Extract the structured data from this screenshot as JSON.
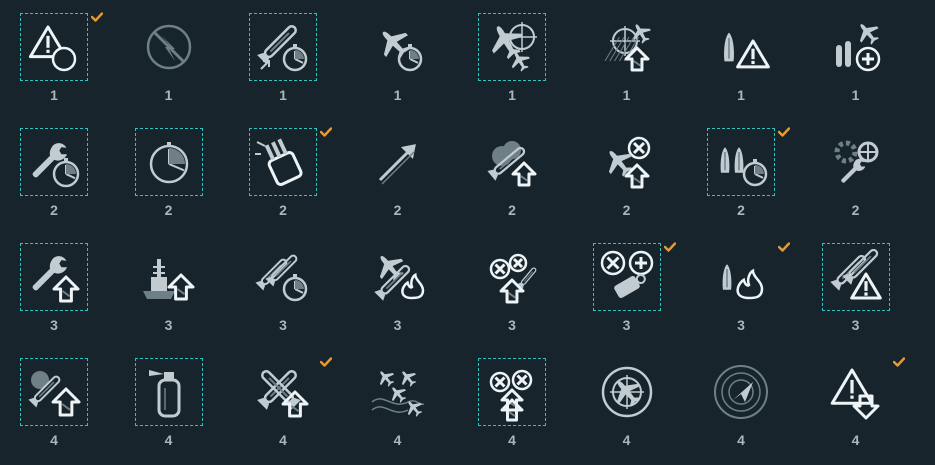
{
  "colors": {
    "background": "#17242c",
    "icon_primary": "#c2ccd0",
    "icon_dim": "#6f7f86",
    "icon_bright": "#eef3f5",
    "selection_border": "#2ec4c0",
    "check": "#e99a2e",
    "tier_text": "#aab6bb"
  },
  "rows": [
    {
      "tier": "1",
      "cells": [
        {
          "icon": "warning-timer-icon",
          "selected": true,
          "checked": true
        },
        {
          "icon": "disabled-aa-icon",
          "selected": false,
          "checked": false
        },
        {
          "icon": "torpedo-timer-icon",
          "selected": true,
          "checked": false
        },
        {
          "icon": "plane-timer-icon",
          "selected": false,
          "checked": false
        },
        {
          "icon": "fighter-squadron-icon",
          "selected": true,
          "checked": false
        },
        {
          "icon": "crosshair-plane-upgrade-icon",
          "selected": false,
          "checked": false
        },
        {
          "icon": "ship-warning-icon",
          "selected": false,
          "checked": false
        },
        {
          "icon": "plane-ammo-heal-icon",
          "selected": false,
          "checked": false
        }
      ]
    },
    {
      "tier": "2",
      "cells": [
        {
          "icon": "wrench-timer-icon",
          "selected": true,
          "checked": false
        },
        {
          "icon": "stopwatch-icon",
          "selected": true,
          "checked": false
        },
        {
          "icon": "turret-icon",
          "selected": true,
          "checked": true
        },
        {
          "icon": "shell-upgrade-icon",
          "selected": false,
          "checked": false
        },
        {
          "icon": "smoke-armor-upgrade-icon",
          "selected": false,
          "checked": false
        },
        {
          "icon": "plane-target-upgrade-icon",
          "selected": false,
          "checked": false
        },
        {
          "icon": "ships-timer-icon",
          "selected": true,
          "checked": true
        },
        {
          "icon": "gears-wrench-icon",
          "selected": false,
          "checked": false
        }
      ]
    },
    {
      "tier": "3",
      "cells": [
        {
          "icon": "wrench-upgrade-icon",
          "selected": true,
          "checked": false
        },
        {
          "icon": "battleship-upgrade-icon",
          "selected": false,
          "checked": false
        },
        {
          "icon": "torpedoes-timer-icon",
          "selected": false,
          "checked": false
        },
        {
          "icon": "plane-fire-icon",
          "selected": false,
          "checked": false
        },
        {
          "icon": "targets-shells-icon",
          "selected": false,
          "checked": false
        },
        {
          "icon": "repair-heal-icon",
          "selected": true,
          "checked": true
        },
        {
          "icon": "ship-fire-icon",
          "selected": false,
          "checked": true
        },
        {
          "icon": "torpedoes-warning-icon",
          "selected": true,
          "checked": false
        }
      ]
    },
    {
      "tier": "4",
      "cells": [
        {
          "icon": "shells-upgrade-icon",
          "selected": true,
          "checked": false
        },
        {
          "icon": "extinguisher-icon",
          "selected": true,
          "checked": false
        },
        {
          "icon": "crossed-torpedoes-upgrade-icon",
          "selected": false,
          "checked": true
        },
        {
          "icon": "planes-map-icon",
          "selected": false,
          "checked": false
        },
        {
          "icon": "targets-double-upgrade-icon",
          "selected": true,
          "checked": false
        },
        {
          "icon": "radar-plane-icon",
          "selected": false,
          "checked": false
        },
        {
          "icon": "radar-compass-icon",
          "selected": false,
          "checked": false
        },
        {
          "icon": "warning-downgrade-icon",
          "selected": false,
          "checked": true
        }
      ]
    }
  ]
}
